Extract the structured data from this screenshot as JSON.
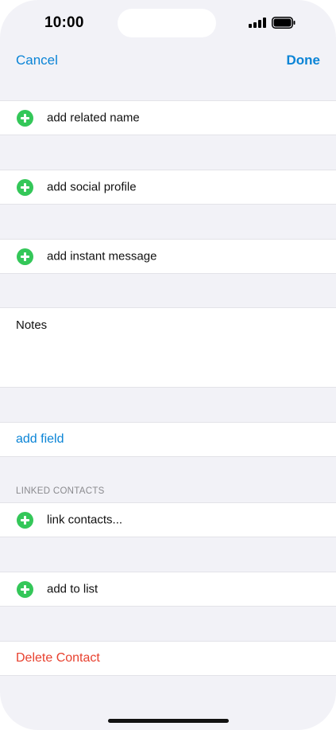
{
  "status_bar": {
    "time": "10:00",
    "signal_icon": "cellular-signal-icon",
    "battery_icon": "battery-icon"
  },
  "nav": {
    "cancel_label": "Cancel",
    "done_label": "Done"
  },
  "rows": {
    "related_name": "add related name",
    "social_profile": "add social profile",
    "instant_message": "add instant message",
    "notes": "Notes",
    "add_field": "add field",
    "linked_contacts_header": "LINKED CONTACTS",
    "link_contacts": "link contacts...",
    "add_to_list": "add to list",
    "delete_contact": "Delete Contact"
  },
  "icons": {
    "add": "plus-circle-icon"
  },
  "colors": {
    "accent": "#0a84d6",
    "add_green": "#34c759",
    "destructive": "#e8412f",
    "background": "#f2f2f7"
  }
}
